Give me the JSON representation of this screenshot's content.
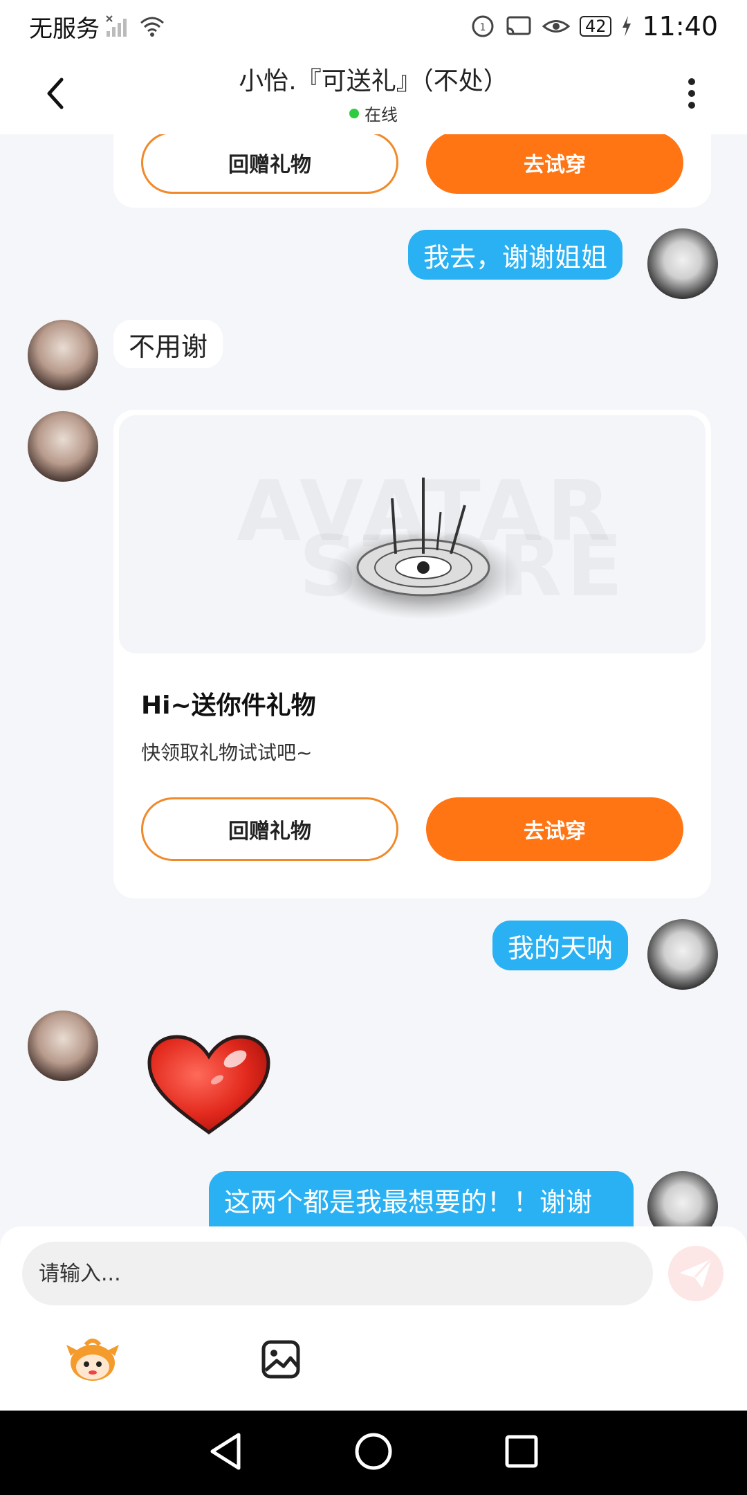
{
  "status_bar": {
    "carrier": "无服务",
    "battery": "42",
    "time": "11:40"
  },
  "header": {
    "title": "小怡.『可送礼』（不处）",
    "status": "在线"
  },
  "messages": {
    "card_top": {
      "return_gift": "回赠礼物",
      "try_on": "去试穿"
    },
    "me_1": "我去，谢谢姐姐",
    "her_1": "不用谢",
    "gift_card": {
      "watermark_1": "AVATAR",
      "watermark_2": "STORE",
      "title": "Hi~送你件礼物",
      "subtitle": "快领取礼物试试吧~",
      "return_gift": "回赠礼物",
      "try_on": "去试穿"
    },
    "me_2": "我的天呐",
    "her_sticker": "heart-sticker",
    "me_3": "这两个都是我最想要的！！谢谢"
  },
  "composer": {
    "placeholder": "请输入...",
    "send_icon": "send-icon",
    "tools": [
      "emoji-mascot-icon",
      "image-icon"
    ]
  },
  "colors": {
    "accent_orange": "#ff7413",
    "bubble_blue": "#2ab1f3",
    "online_green": "#2ecc40"
  }
}
